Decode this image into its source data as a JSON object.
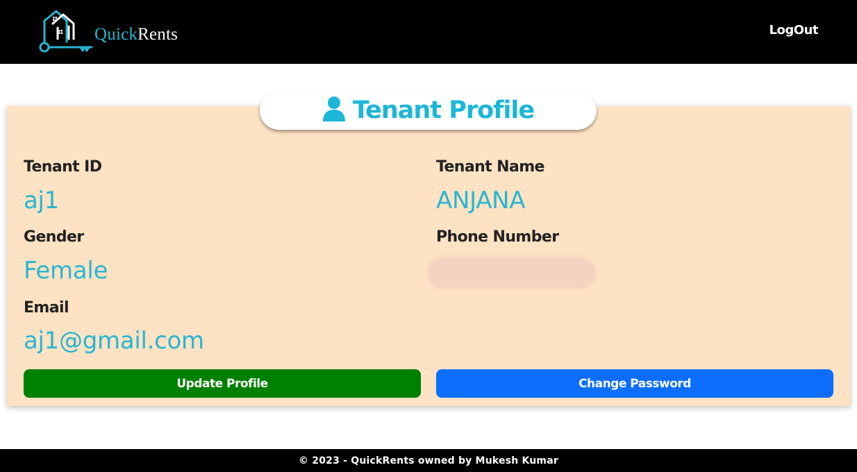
{
  "brand": {
    "quick": "Quick",
    "rents": "Rents",
    "icon": "house-key-icon"
  },
  "nav": {
    "logout_label": "LogOut"
  },
  "profile": {
    "title": "Tenant Profile",
    "title_icon": "user-icon",
    "tenant_id_label": "Tenant ID",
    "tenant_id_value": "aj1",
    "tenant_name_label": "Tenant Name",
    "tenant_name_value": "ANJANA",
    "gender_label": "Gender",
    "gender_value": "Female",
    "phone_label": "Phone Number",
    "email_label": "Email",
    "email_value": "aj1@gmail.com"
  },
  "actions": {
    "update_label": "Update Profile",
    "change_password_label": "Change Password"
  },
  "footer": {
    "text": "© 2023 - QuickRents owned by Mukesh Kumar"
  },
  "colors": {
    "accent": "#27b6d2",
    "card_bg": "#fde2c3",
    "update_btn": "#008000",
    "password_btn": "#0d6efd",
    "nav_bg": "#000000"
  }
}
